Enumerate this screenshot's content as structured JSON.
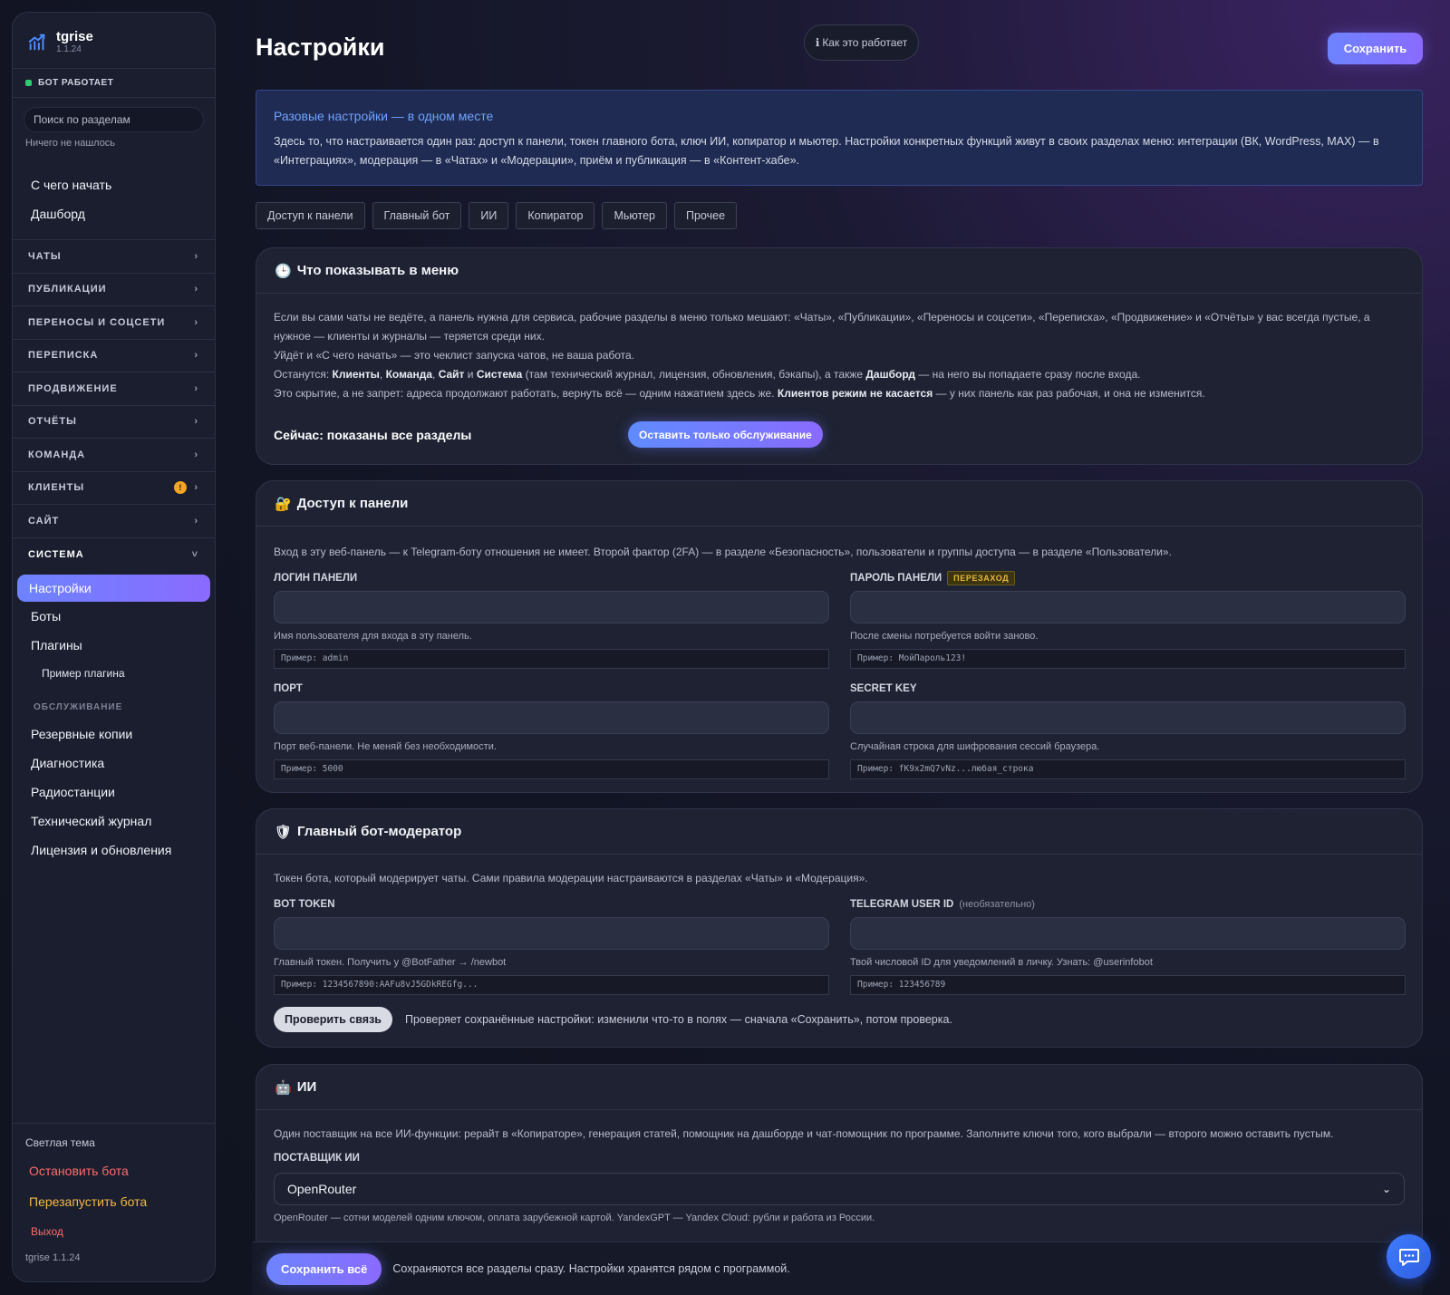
{
  "sidebar": {
    "brand": {
      "name": "tgrise",
      "version": "1.1.24"
    },
    "status": "БОТ РАБОТАЕТ",
    "search_placeholder": "Поиск по разделам",
    "nothing_found": "Ничего не нашлось",
    "top_links": [
      "С чего начать",
      "Дашборд"
    ],
    "groups": [
      "ЧАТЫ",
      "ПУБЛИКАЦИИ",
      "ПЕРЕНОСЫ И СОЦСЕТИ",
      "ПЕРЕПИСКА",
      "ПРОДВИЖЕНИЕ",
      "ОТЧЁТЫ",
      "КОМАНДА",
      "КЛИЕНТЫ",
      "САЙТ"
    ],
    "clients_badge": "!",
    "open_group": "СИСТЕМА",
    "system_items": {
      "active": "Настройки",
      "bots": "Боты",
      "plugins": "Плагины",
      "plugin_example": "Пример плагина",
      "service_heading": "ОБСЛУЖИВАНИЕ",
      "backups": "Резервные копии",
      "diagnostics": "Диагностика",
      "radio": "Радиостанции",
      "techlog": "Технический журнал",
      "license": "Лицензия и обновления"
    },
    "footer": {
      "theme": "Светлая тема",
      "stop": "Остановить бота",
      "restart": "Перезапустить бота",
      "logout": "Выход",
      "version": "tgrise 1.1.24"
    }
  },
  "header": {
    "title": "Настройки",
    "how_it_works": "Как это работает",
    "save": "Сохранить"
  },
  "info": {
    "title": "Разовые настройки — в одном месте",
    "text": "Здесь то, что настраивается один раз: доступ к панели, токен главного бота, ключ ИИ, копиратор и мьютер. Настройки конкретных функций живут в своих разделах меню: интеграции (ВК, WordPress, MAX) — в «Интеграциях», модерация — в «Чатах» и «Модерации», приём и публикация — в «Контент-хабе»."
  },
  "tabs": [
    "Доступ к панели",
    "Главный бот",
    "ИИ",
    "Копиратор",
    "Мьютер",
    "Прочее"
  ],
  "menu_card": {
    "title": "Что показывать в меню",
    "p1": "Если вы сами чаты не ведёте, а панель нужна для сервиса, рабочие разделы в меню только мешают: «Чаты», «Публикации», «Переносы и соцсети», «Переписка», «Продвижение» и «Отчёты» у вас всегда пустые, а нужное — клиенты и журналы — теряется среди них.",
    "p2": "Уйдёт и «С чего начать» — это чеклист запуска чатов, не ваша работа.",
    "p3_a": "Останутся: ",
    "p3_b1": "Клиенты",
    "p3_c1": ", ",
    "p3_b2": "Команда",
    "p3_c2": ", ",
    "p3_b3": "Сайт",
    "p3_c3": " и ",
    "p3_b4": "Система",
    "p3_c4": " (там технический журнал, лицензия, обновления, бэкапы), а также ",
    "p3_b5": "Дашборд",
    "p3_c5": " — на него вы попадаете сразу после входа.",
    "p4_a": "Это скрытие, а не запрет: адреса продолжают работать, вернуть всё — одним нажатием здесь же. ",
    "p4_b": "Клиентов режим не касается",
    "p4_c": " — у них панель как раз рабочая, и она не изменится.",
    "status": "Сейчас: показаны все разделы",
    "button": "Оставить только обслуживание"
  },
  "access_card": {
    "title": "Доступ к панели",
    "desc": "Вход в эту веб-панель — к Telegram-боту отношения не имеет. Второй фактор (2FA) — в разделе «Безопасность», пользователи и группы доступа — в разделе «Пользователи».",
    "login_label": "ЛОГИН ПАНЕЛИ",
    "login_hint": "Имя пользователя для входа в эту панель.",
    "login_example": "Пример: admin",
    "password_label": "ПАРОЛЬ ПАНЕЛИ",
    "password_tag": "ПЕРЕЗАХОД",
    "password_hint": "После смены потребуется войти заново.",
    "password_example": "Пример: МойПароль123!",
    "port_label": "ПОРТ",
    "port_hint": "Порт веб-панели. Не меняй без необходимости.",
    "port_example": "Пример: 5000",
    "secret_label": "SECRET KEY",
    "secret_hint": "Случайная строка для шифрования сессий браузера.",
    "secret_example": "Пример: fK9x2mQ7vNz...любая_строка"
  },
  "bot_card": {
    "title": "Главный бот-модератор",
    "desc": "Токен бота, который модерирует чаты. Сами правила модерации настраиваются в разделах «Чаты» и «Модерация».",
    "token_label": "BOT TOKEN",
    "token_hint": "Главный токен. Получить у @BotFather → /newbot",
    "token_example": "Пример: 1234567890:AAFu8vJ5GDkREGfg...",
    "uid_label": "TELEGRAM USER ID",
    "uid_optional": "(необязательно)",
    "uid_hint": "Твой числовой ID для уведомлений в личку. Узнать: @userinfobot",
    "uid_example": "Пример: 123456789",
    "check_button": "Проверить связь",
    "check_note": "Проверяет сохранённые настройки: изменили что-то в полях — сначала «Сохранить», потом проверка."
  },
  "ai_card": {
    "title": "ИИ",
    "desc": "Один поставщик на все ИИ-функции: рерайт в «Копираторе», генерация статей, помощник на дашборде и чат-помощник по программе. Заполните ключи того, кого выбрали — второго можно оставить пустым.",
    "provider_label": "ПОСТАВЩИК ИИ",
    "provider_value": "OpenRouter",
    "provider_hint": "OpenRouter — сотни моделей одним ключом, оплата зарубежной картой. YandexGPT — Yandex Cloud: рубли и работа из России."
  },
  "bottom_bar": {
    "save_all": "Сохранить всё",
    "note": "Сохраняются все разделы сразу. Настройки хранятся рядом с программой."
  },
  "colors": {
    "accent": "#7b78ff",
    "status_ok": "#2ecc71",
    "danger": "#ff6b6b",
    "warning": "#f5b942",
    "info_title": "#6fa2ff"
  }
}
